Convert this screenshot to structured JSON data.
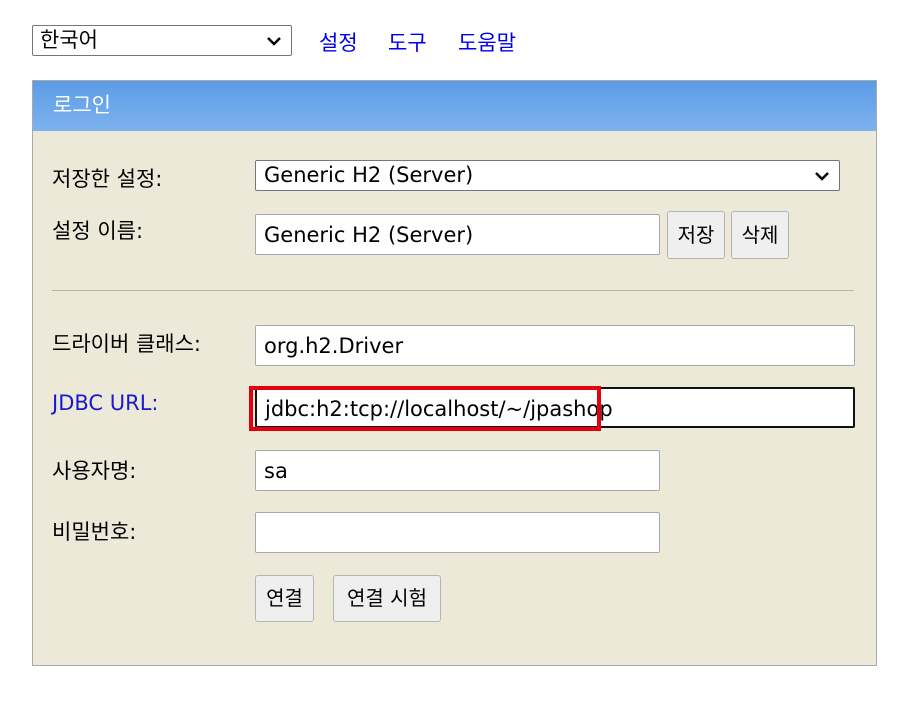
{
  "top": {
    "language_value": "한국어",
    "links": [
      "설정",
      "도구",
      "도움말"
    ]
  },
  "panel": {
    "title": "로그인",
    "saved_settings_label": "저장한 설정:",
    "saved_settings_value": "Generic H2 (Server)",
    "setting_name_label": "설정 이름:",
    "setting_name_value": "Generic H2 (Server)",
    "save_button": "저장",
    "delete_button": "삭제",
    "driver_label": "드라이버 클래스:",
    "driver_value": "org.h2.Driver",
    "jdbc_label": "JDBC URL:",
    "jdbc_value": "jdbc:h2:tcp://localhost/~/jpashop",
    "user_label": "사용자명:",
    "user_value": "sa",
    "password_label": "비밀번호:",
    "password_value": "",
    "connect_button": "연결",
    "test_button": "연결 시험"
  },
  "colors": {
    "header_gradient_top": "#5c9ce6",
    "panel_bg": "#ece9d8",
    "link": "#0000ee",
    "highlight": "#e3000f"
  }
}
